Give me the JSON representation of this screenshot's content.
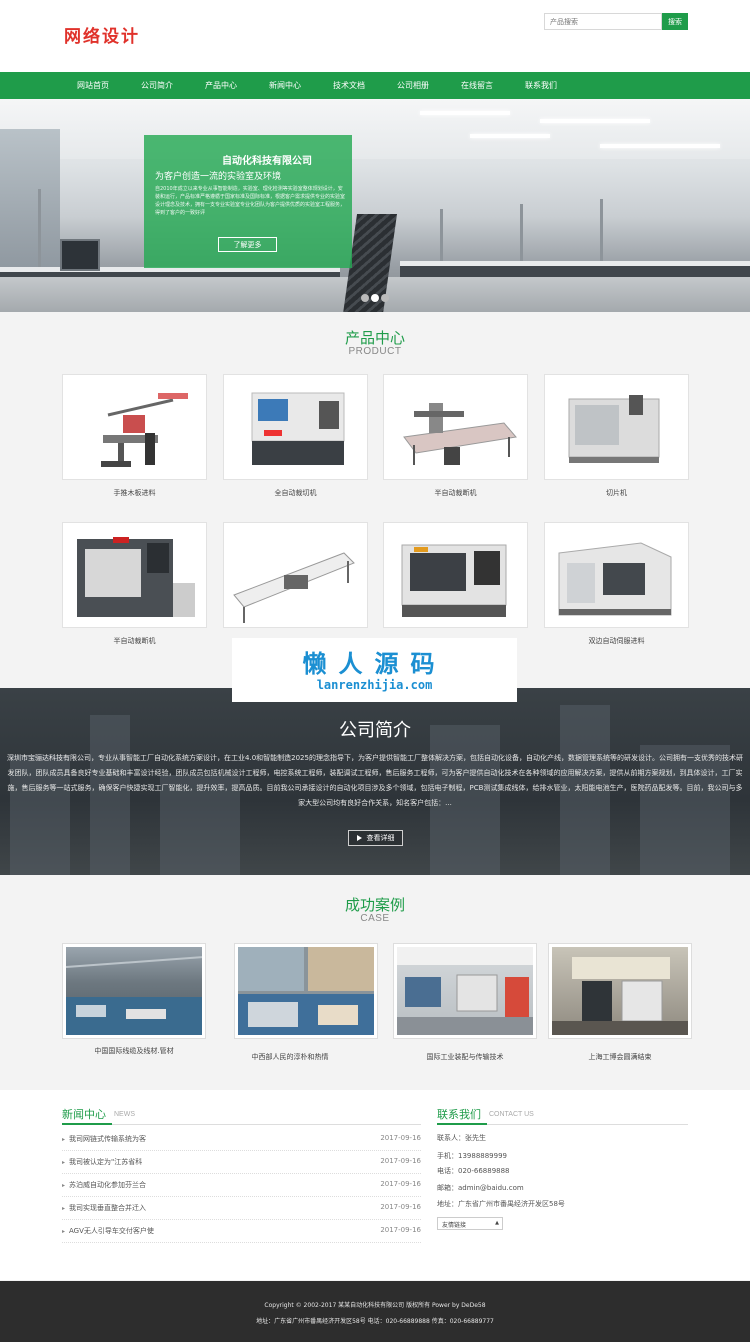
{
  "header": {
    "logo": "网络设计",
    "search_placeholder": "产品搜索",
    "search_button": "搜索"
  },
  "nav": [
    "网站首页",
    "公司简介",
    "产品中心",
    "新闻中心",
    "技术文档",
    "公司相册",
    "在线留言",
    "联系我们"
  ],
  "banner": {
    "title": "自动化科技有限公司",
    "subtitle": "为客户创造一流的实验室及环境",
    "description": "自2010年成立以来专业从事智能制造，实验室、理化检测等实验室整体规划设计，安装和运行，产品标准严格遵循于国家标准及国际标准，根据客户需求提供专业的实验室设计理念及技术，拥有一支专业实验室专业化团队为客户提供优质的实验室工程服务，得到了客户的一致好评",
    "button": "了解更多",
    "active_slide": 2,
    "slide_count": 3
  },
  "products": {
    "title": "产品中心",
    "subtitle": "PRODUCT",
    "items": [
      "手推木板进料",
      "全自动裁切机",
      "半自动裁断机",
      "切片机",
      "半自动裁断机",
      "",
      "",
      "双边自动伺服进料"
    ]
  },
  "watermark": {
    "title": "懒人源码",
    "url": "lanrenzhijia.com"
  },
  "about": {
    "title": "公司简介",
    "text": "深圳市宝骊达科技有限公司，专业从事智能工厂自动化系统方案设计，在工业4.0和智能制造2025的理念指导下，为客户提供智能工厂整体解决方案，包括自动化设备，自动化产线，数据管理系统等的研发设计。公司拥有一支优秀的技术研发团队，团队成员具备良好专业基础和丰富设计经验，团队成员包括机械设计工程师，电控系统工程师，装配调试工程师，售后服务工程师，可为客户提供自动化技术在各种领域的应用解决方案，提供从前期方案规划，到具体设计，工厂实施，售后服务等一站式服务，确保客户快捷实现工厂智能化，提升效率，提高品质。目前我公司承接设计的自动化项目涉及多个领域，包括电子制程，PCB测试集成线体，给排水管业，太阳能电池生产，医院药品配发等。目前，我公司与多家大型公司均有良好合作关系，知名客户包括：...",
    "button": "查看详细"
  },
  "cases": {
    "title": "成功案例",
    "subtitle": "CASE",
    "items": [
      "中国国际线缆及线材.管材",
      "中西部人民的淳朴和热情",
      "国际工业装配与传输技术",
      "上海工博会圆满结束"
    ]
  },
  "news": {
    "title": "新闻中心",
    "title_en": "NEWS",
    "items": [
      {
        "title": "我司网链式传输系统为客",
        "date": "2017-09-16"
      },
      {
        "title": "我司被认定为\"江苏省科",
        "date": "2017-09-16"
      },
      {
        "title": "苏泊威自动化参加芬兰合",
        "date": "2017-09-16"
      },
      {
        "title": "我司实现垂直整合并迁入",
        "date": "2017-09-16"
      },
      {
        "title": "AGV无人引导车交付客户使",
        "date": "2017-09-16"
      }
    ]
  },
  "contact": {
    "title": "联系我们",
    "title_en": "CONTACT US",
    "lines": [
      "联系人：张先生",
      "手机：13988889999",
      "电话：020-66889888",
      "邮箱：admin@baidu.com",
      "地址：广东省广州市番禺经济开发区58号"
    ],
    "friend_links": "友情链接"
  },
  "footer": {
    "copyright": "Copyright © 2002-2017 某某自动化科技有限公司 版权所有 Power by DeDe58",
    "info": "地址：广东省广州市番禺经济开发区58号  电话：020-66889888  传真：020-66889777"
  },
  "colors": {
    "brand_green": "#1f9c4a",
    "logo_red": "#e0322b",
    "watermark_blue": "#1b8fd2",
    "footer_bg": "#2d2d2d"
  }
}
